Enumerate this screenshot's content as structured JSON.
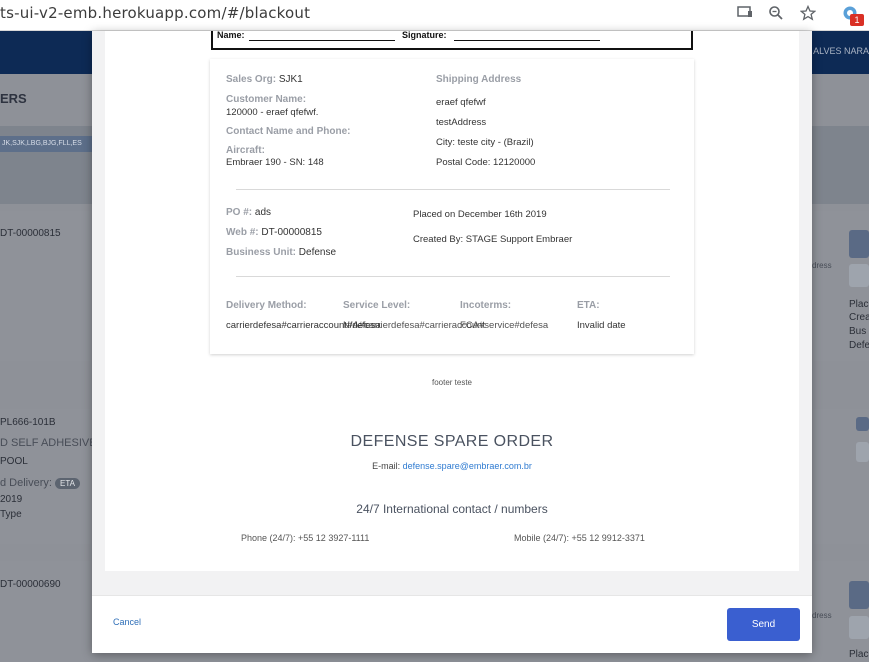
{
  "browser": {
    "url": "ts-ui-v2-emb.herokuapp.com/#/blackout",
    "extension_badge": "1"
  },
  "background": {
    "user_name": "ALVES NARA",
    "page_title": "ERS",
    "filters": "JK,SJK,LBG,BJG,FLL,ES",
    "card1": {
      "id": "DT-00000815",
      "address_label": "dress",
      "part_number": "PL666-101B",
      "description": "D SELF ADHESIVE",
      "extra": "POOL",
      "delivery_label": "d Delivery:",
      "eta_badge": "ETA",
      "year": "2019",
      "type_label": "Type",
      "right_labels": [
        "Plac",
        "Crea",
        "Bus",
        "Defe"
      ]
    },
    "card2": {
      "id": "DT-00000690",
      "address_label": "dress",
      "right_label": "Plac"
    }
  },
  "modal": {
    "signature": {
      "name_label": "Name:",
      "signature_label": "Signature:"
    },
    "sales": {
      "sales_org_label": "Sales Org:",
      "sales_org_value": "SJK1",
      "customer_name_label": "Customer Name:",
      "customer_name_value": "120000 - eraef qfefwf.",
      "contact_label": "Contact Name and Phone:",
      "aircraft_label": "Aircraft:",
      "aircraft_value": "Embraer 190 - SN: 148"
    },
    "shipping": {
      "label": "Shipping Address",
      "lines": [
        "eraef qfefwf",
        "testAddress",
        "City: teste city - (Brazil)",
        "Postal Code: 12120000"
      ]
    },
    "order": {
      "po_label": "PO #:",
      "po_value": "ads",
      "web_label": "Web #:",
      "web_value": "DT-00000815",
      "bu_label": "Business Unit:",
      "bu_value": "Defense",
      "placed_on": "Placed on December 16th 2019",
      "created_by": "Created By: STAGE Support Embraer"
    },
    "delivery": {
      "method_label": "Delivery Method:",
      "method_value": "carrierdefesa#carrieraccount#defesa",
      "service_label": "Service Level:",
      "service_value": "N/A#carrierdefesa#carrieraccount",
      "incoterms_label": "Incoterms:",
      "incoterms_value": "FCA#service#defesa",
      "eta_label": "ETA:",
      "eta_value": "Invalid date"
    },
    "footer_note": "footer teste",
    "order_title": "DEFENSE SPARE ORDER",
    "email_label": "E-mail:",
    "email_value": "defense.spare@embraer.com.br",
    "contact_title": "24/7 International contact / numbers",
    "phone": "Phone (24/7): +55 12 3927-1111",
    "mobile": "Mobile (24/7): +55 12 9912-3371",
    "cancel_label": "Cancel",
    "send_label": "Send"
  }
}
